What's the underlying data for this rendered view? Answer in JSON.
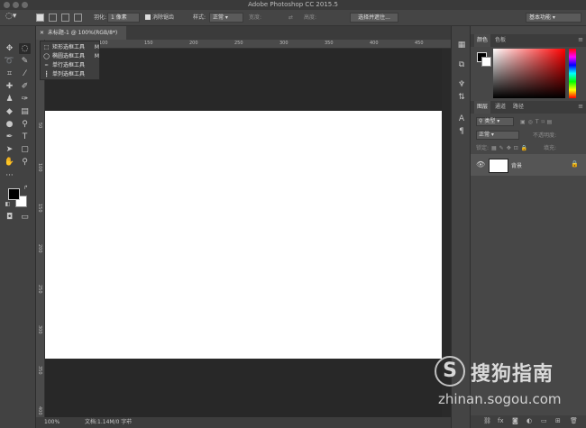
{
  "app": {
    "title": "Adobe Photoshop CC 2015.5"
  },
  "options_bar": {
    "feather_label": "羽化:",
    "feather_value": "1 像素",
    "antialias_label": "消除锯齿",
    "style_label": "样式:",
    "style_value": "正常",
    "width_label": "宽度:",
    "height_label": "高度:",
    "select_mask_button": "选择并遮住...",
    "workspace_value": "基本功能"
  },
  "document": {
    "tab_title": "未标题-1 @ 100%(RGB/8*)",
    "zoom": "100%",
    "doc_info": "文档:1.14M/0 字节"
  },
  "ruler": {
    "h_labels": [
      "50",
      "100",
      "150",
      "200",
      "250",
      "300",
      "350",
      "400",
      "450"
    ],
    "v_labels": [
      "50",
      "100",
      "150",
      "200",
      "250",
      "300",
      "350",
      "400"
    ]
  },
  "marquee_flyout": {
    "items": [
      {
        "label": "矩形选框工具",
        "key": "M",
        "icon": "rectangular-marquee-icon"
      },
      {
        "label": "椭圆选框工具",
        "key": "M",
        "icon": "elliptical-marquee-icon"
      },
      {
        "label": "单行选框工具",
        "key": "",
        "icon": "single-row-marquee-icon"
      },
      {
        "label": "单列选框工具",
        "key": "",
        "icon": "single-column-marquee-icon"
      }
    ]
  },
  "color_panel": {
    "tabs": [
      "颜色",
      "色板"
    ]
  },
  "layers_panel": {
    "tabs": [
      "图层",
      "通道",
      "路径"
    ],
    "filter_kind": "类型",
    "blend_mode": "正常",
    "opacity_label": "不透明度:",
    "lock_label": "锁定:",
    "fill_label": "填充:",
    "layers": [
      {
        "name": "背景"
      }
    ]
  },
  "watermark": {
    "brand": "搜狗指南",
    "url": "zhinan.sogou.com"
  }
}
